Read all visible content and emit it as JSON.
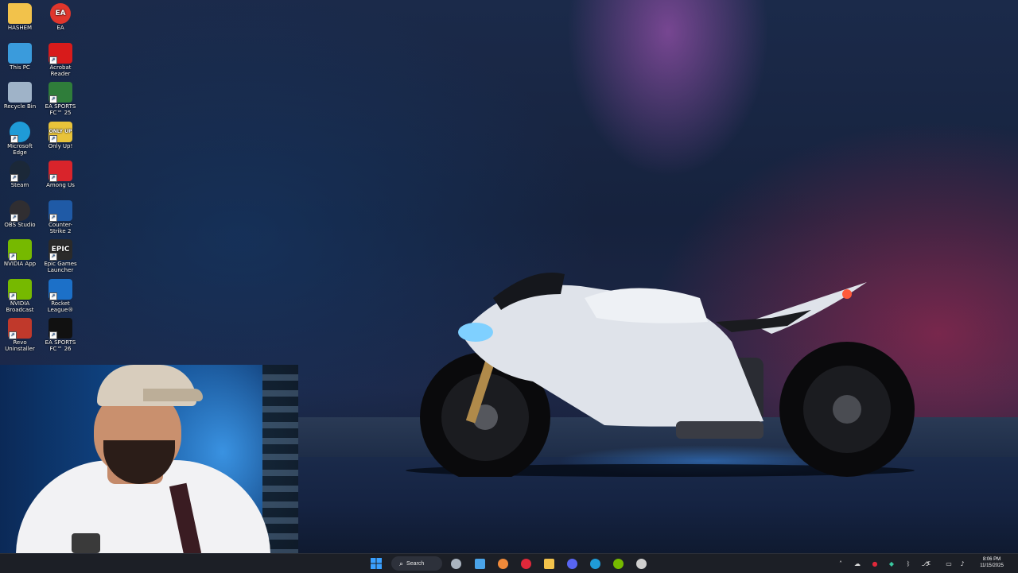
{
  "desktop": {
    "icons": [
      {
        "label": "HASHEM",
        "icon": "folder-icon",
        "color": "#f2c24b"
      },
      {
        "label": "EA",
        "icon": "ea-icon",
        "color": "#e0362c",
        "glyph": "EA"
      },
      {
        "label": "This PC",
        "icon": "monitor-icon",
        "color": "#3a9bdc"
      },
      {
        "label": "Acrobat Reader",
        "icon": "acrobat-icon",
        "color": "#d81b1b"
      },
      {
        "label": "Recycle Bin",
        "icon": "recycle-bin-icon",
        "color": "#9fb3c8"
      },
      {
        "label": "EA SPORTS FC™ 25",
        "icon": "ea-fc25-icon",
        "color": "#2f7d3a"
      },
      {
        "label": "Microsoft Edge",
        "icon": "edge-icon",
        "color": "#1f9bd7"
      },
      {
        "label": "Only Up!",
        "icon": "only-up-icon",
        "color": "#e8c33a",
        "glyph": "ONLY UP"
      },
      {
        "label": "Steam",
        "icon": "steam-icon",
        "color": "#1b2838"
      },
      {
        "label": "Among Us",
        "icon": "among-us-icon",
        "color": "#d9242b"
      },
      {
        "label": "OBS Studio",
        "icon": "obs-icon",
        "color": "#302e31"
      },
      {
        "label": "Counter-Strike 2",
        "label_display": "Counter-Str...\n2",
        "icon": "counter-strike-icon",
        "color": "#1f5aa6"
      },
      {
        "label": "NVIDIA App",
        "icon": "nvidia-icon",
        "color": "#76b900"
      },
      {
        "label": "Epic Games Launcher",
        "icon": "epic-games-icon",
        "color": "#2a2a2a",
        "glyph": "EPIC"
      },
      {
        "label": "NVIDIA Broadcast",
        "icon": "nvidia-broadcast-icon",
        "color": "#76b900"
      },
      {
        "label": "Rocket League®",
        "icon": "rocket-league-icon",
        "color": "#1c70c8"
      },
      {
        "label": "Revo Uninstaller",
        "icon": "revo-uninstaller-icon",
        "color": "#c0392b"
      },
      {
        "label": "EA SPORTS FC™ 26",
        "icon": "ea-fc26-icon",
        "color": "#111111"
      }
    ]
  },
  "taskbar": {
    "search_label": "Search",
    "apps": [
      {
        "icon": "start-icon",
        "color": "#3aa0ff"
      },
      {
        "icon": "settings-icon",
        "color": "#aab4c0"
      },
      {
        "icon": "photos-icon",
        "color": "#4aa3e8"
      },
      {
        "icon": "cloud-app-icon",
        "color": "#f08a3a"
      },
      {
        "icon": "red-app-icon",
        "color": "#e0283a"
      },
      {
        "icon": "file-explorer-icon",
        "color": "#f2c24b"
      },
      {
        "icon": "discord-icon",
        "color": "#5865f2"
      },
      {
        "icon": "edge-icon",
        "color": "#1f9bd7"
      },
      {
        "icon": "nvidia-icon",
        "color": "#76b900"
      },
      {
        "icon": "obs-icon",
        "color": "#cfcfcf"
      }
    ],
    "tray": {
      "icons": [
        "chevron-up-icon",
        "onedrive-icon",
        "red-tray-icon",
        "vpn-icon",
        "bluetooth-icon",
        "microphone-icon",
        "pound-icon",
        "network-icon",
        "volume-icon"
      ],
      "language": "£"
    },
    "clock": {
      "time": "8:06 PM",
      "date": "11/15/2025"
    }
  }
}
